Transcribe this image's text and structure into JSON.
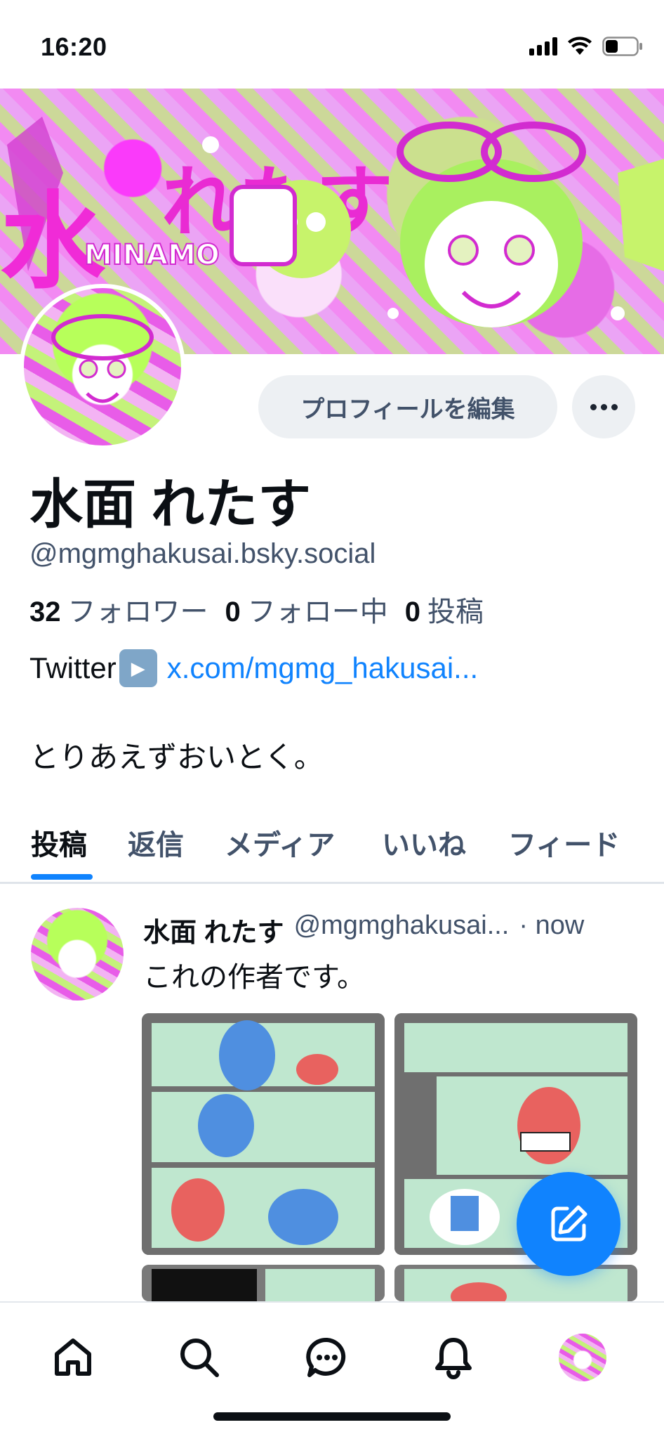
{
  "status_bar": {
    "time": "16:20"
  },
  "profile": {
    "display_name": "水面 れたす",
    "handle": "@mgmghakusai.bsky.social",
    "followers_count": "32",
    "followers_label": "フォロワー",
    "following_count": "0",
    "following_label": "フォロー中",
    "posts_count": "0",
    "posts_label": "投稿",
    "bio_prefix": "Twitter",
    "bio_link": "x.com/mgmg_hakusai...",
    "bio_text": "とりあえずおいとく。",
    "edit_button": "プロフィールを編集"
  },
  "tabs": [
    {
      "label": "投稿",
      "active": true
    },
    {
      "label": "返信",
      "active": false
    },
    {
      "label": "メディア",
      "active": false
    },
    {
      "label": "いいね",
      "active": false
    },
    {
      "label": "フィード",
      "active": false
    }
  ],
  "post": {
    "author_name": "水面 れたす",
    "author_handle": "@mgmghakusai...",
    "time": "· now",
    "text": "これの作者です。"
  },
  "icons": {
    "play": "play-button-emoji",
    "compose": "compose-icon",
    "nav": [
      "home-icon",
      "search-icon",
      "chat-icon",
      "bell-icon",
      "profile-avatar"
    ]
  },
  "colors": {
    "accent": "#1083fe",
    "muted_text": "#42526a",
    "button_bg": "#edf0f3"
  }
}
